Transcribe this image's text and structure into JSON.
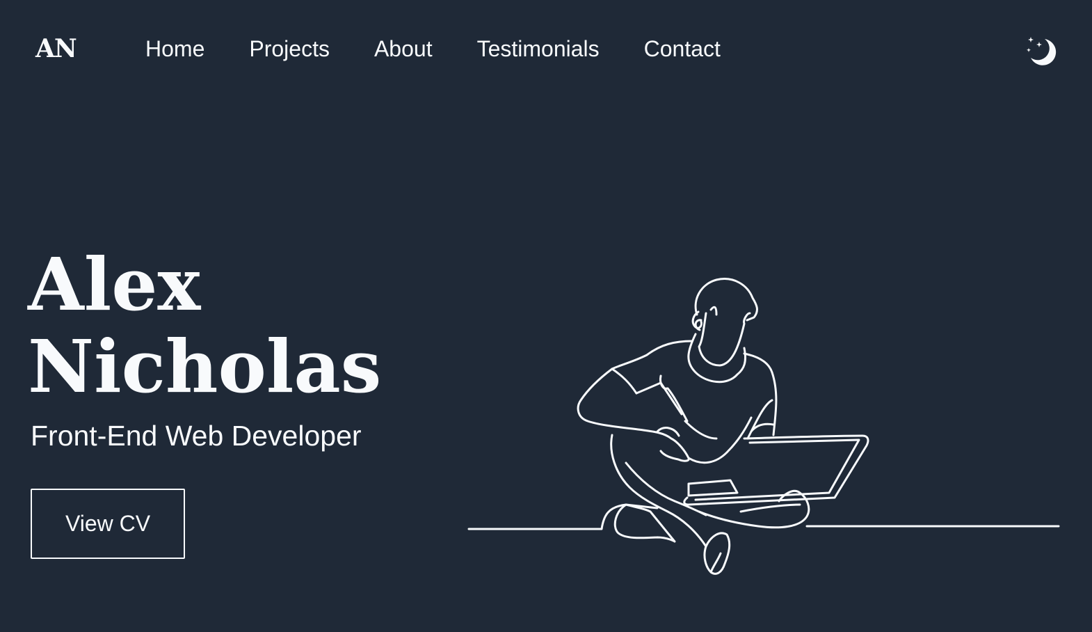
{
  "header": {
    "logo": "AN",
    "nav": [
      {
        "label": "Home"
      },
      {
        "label": "Projects"
      },
      {
        "label": "About"
      },
      {
        "label": "Testimonials"
      },
      {
        "label": "Contact"
      }
    ],
    "theme_toggle_icon": "moon-stars-icon"
  },
  "hero": {
    "first_name": "Alex",
    "last_name": "Nicholas",
    "subtitle": "Front-End Web Developer",
    "cv_button": "View CV",
    "illustration_icon": "person-with-laptop-line-art"
  },
  "colors": {
    "background": "#1f2937",
    "foreground": "#f8fafc"
  }
}
